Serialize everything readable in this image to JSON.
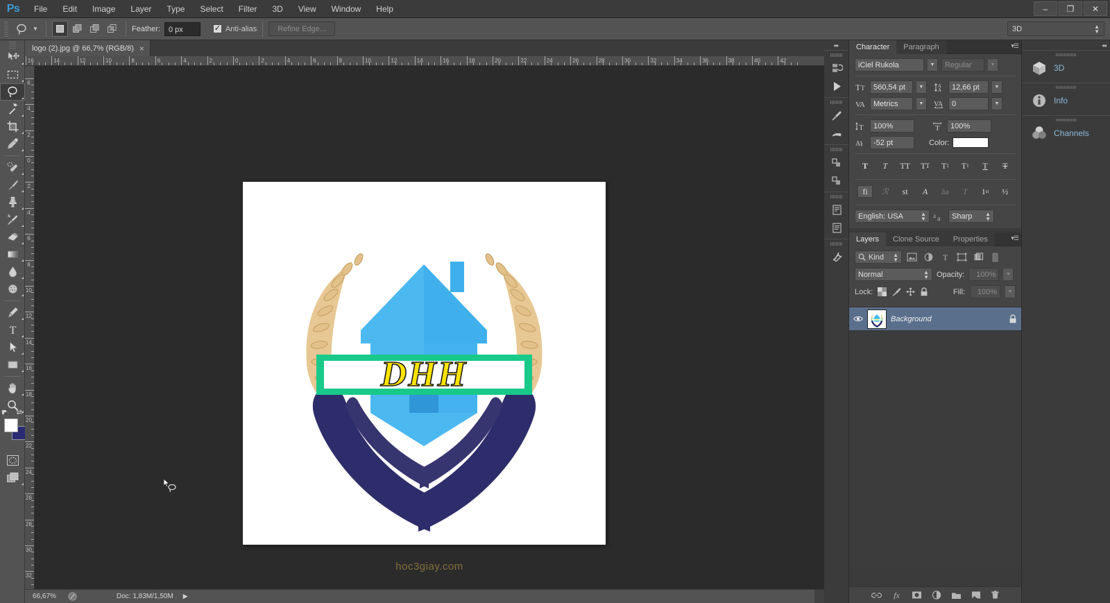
{
  "app": {
    "name": "Adobe Photoshop",
    "logo_text": "Ps"
  },
  "menubar": {
    "items": [
      {
        "label": "File"
      },
      {
        "label": "Edit"
      },
      {
        "label": "Image"
      },
      {
        "label": "Layer"
      },
      {
        "label": "Type"
      },
      {
        "label": "Select"
      },
      {
        "label": "Filter"
      },
      {
        "label": "3D"
      },
      {
        "label": "View"
      },
      {
        "label": "Window"
      },
      {
        "label": "Help"
      }
    ]
  },
  "window_controls": {
    "minimize": "–",
    "restore": "❐",
    "close": "✕"
  },
  "options_bar": {
    "tool_name": "lasso-tool",
    "selection_modes": [
      "new-selection",
      "add-to-selection",
      "subtract-from-selection",
      "intersect-with-selection"
    ],
    "active_selection_mode": 0,
    "feather_label": "Feather:",
    "feather_value": "0 px",
    "antialias_label": "Anti-alias",
    "antialias_checked": true,
    "refine_edge_label": "Refine Edge...",
    "refine_edge_enabled": false,
    "workspace_value": "3D"
  },
  "toolbar": {
    "tools": [
      {
        "name": "move-tool",
        "has_flyout": true,
        "active": false
      },
      {
        "name": "rectangular-marquee-tool",
        "has_flyout": true,
        "active": false
      },
      {
        "name": "lasso-tool",
        "has_flyout": true,
        "active": true
      },
      {
        "name": "magic-wand-tool",
        "has_flyout": true,
        "active": false
      },
      {
        "name": "crop-tool",
        "has_flyout": true,
        "active": false
      },
      {
        "name": "eyedropper-tool",
        "has_flyout": true,
        "active": false
      },
      {
        "name": "spot-healing-brush-tool",
        "has_flyout": true,
        "active": false
      },
      {
        "name": "brush-tool",
        "has_flyout": true,
        "active": false
      },
      {
        "name": "clone-stamp-tool",
        "has_flyout": true,
        "active": false
      },
      {
        "name": "history-brush-tool",
        "has_flyout": true,
        "active": false
      },
      {
        "name": "eraser-tool",
        "has_flyout": true,
        "active": false
      },
      {
        "name": "gradient-tool",
        "has_flyout": true,
        "active": false
      },
      {
        "name": "blur-tool",
        "has_flyout": true,
        "active": false
      },
      {
        "name": "dodge-tool",
        "has_flyout": true,
        "active": false
      },
      {
        "name": "pen-tool",
        "has_flyout": true,
        "active": false
      },
      {
        "name": "horizontal-type-tool",
        "has_flyout": true,
        "active": false
      },
      {
        "name": "path-selection-tool",
        "has_flyout": true,
        "active": false
      },
      {
        "name": "rectangle-tool",
        "has_flyout": true,
        "active": false
      },
      {
        "name": "hand-tool",
        "has_flyout": true,
        "active": false
      },
      {
        "name": "zoom-tool",
        "has_flyout": true,
        "active": false
      }
    ],
    "foreground_color": "#ffffff",
    "background_color": "#2a2a72",
    "quick_mask_name": "quick-mask-mode",
    "screen_mode_name": "screen-mode"
  },
  "document": {
    "tab_title": "logo (2).jpg @ 66,7% (RGB/8)",
    "close_label": "×",
    "ruler_h_labels": [
      "16",
      "14",
      "12",
      "10",
      "8",
      "6",
      "4",
      "2",
      "0",
      "2",
      "4",
      "6",
      "8",
      "10",
      "12",
      "14",
      "16",
      "18",
      "20",
      "22",
      "24",
      "26",
      "28",
      "30",
      "32",
      "34",
      "36",
      "38",
      "40",
      "42"
    ],
    "ruler_v_labels": [
      "6",
      "4",
      "2",
      "0",
      "2",
      "4",
      "6",
      "8",
      "10",
      "12",
      "14",
      "16",
      "18",
      "20",
      "22",
      "24",
      "26",
      "28",
      "30",
      "32"
    ],
    "canvas_background": "#ffffff",
    "watermark": "hoc3giay.com"
  },
  "logo_artwork": {
    "banner_text": "DHH",
    "banner_text_color": "#ffe300",
    "banner_border_color": "#18c98a",
    "banner_fill_color": "#ffffff",
    "house_color": "#4cb8f0",
    "house_color_dark": "#3aa6e3",
    "hands_color": "#2e2d6b",
    "wheat_color": "#e2c18a"
  },
  "status_bar": {
    "zoom": "66,67%",
    "doc_info": "Doc: 1,83M/1,50M",
    "arrow": "▶"
  },
  "character_panel": {
    "tabs": [
      {
        "label": "Character",
        "active": true
      },
      {
        "label": "Paragraph",
        "active": false
      }
    ],
    "font_family": "iCiel Rukola",
    "font_style": "Regular",
    "font_style_enabled": false,
    "font_size": "560,54 pt",
    "leading": "12,66 pt",
    "kerning": "Metrics",
    "tracking": "0",
    "vertical_scale": "100%",
    "horizontal_scale": "100%",
    "baseline_shift": "-52 pt",
    "color_label": "Color:",
    "color_value": "#ffffff",
    "style_buttons": [
      "faux-bold",
      "faux-italic",
      "all-caps",
      "small-caps",
      "superscript",
      "subscript",
      "underline",
      "strikethrough"
    ],
    "opentype_buttons": [
      "standard-ligatures",
      "contextual-alternates",
      "discretionary-ligatures",
      "swash",
      "old-style",
      "titling-alternates",
      "ordinals",
      "fractions"
    ],
    "language": "English: USA",
    "antialias_method": "Sharp"
  },
  "layers_panel": {
    "tabs": [
      {
        "label": "Layers",
        "active": true
      },
      {
        "label": "Clone Source",
        "active": false
      },
      {
        "label": "Properties",
        "active": false
      }
    ],
    "filter_kind": "Kind",
    "filter_icons": [
      "filter-pixel-layers",
      "filter-adjustment-layers",
      "filter-type-layers",
      "filter-shape-layers",
      "filter-smart-objects"
    ],
    "blend_mode": "Normal",
    "opacity_label": "Opacity:",
    "opacity_value": "100%",
    "lock_label": "Lock:",
    "lock_icons": [
      "lock-transparent-pixels",
      "lock-image-pixels",
      "lock-position",
      "lock-all"
    ],
    "fill_label": "Fill:",
    "fill_value": "100%",
    "layers": [
      {
        "name": "Background",
        "visible": true,
        "locked": true,
        "selected": true
      }
    ],
    "footer_icons": [
      "link-layers",
      "add-layer-style",
      "add-layer-mask",
      "new-adjustment-layer",
      "new-group",
      "new-layer",
      "delete-layer"
    ]
  },
  "right_dock": {
    "items": [
      {
        "label": "3D",
        "icon": "cube-icon"
      },
      {
        "label": "Info",
        "icon": "info-icon"
      },
      {
        "label": "Channels",
        "icon": "channels-icon"
      }
    ]
  }
}
